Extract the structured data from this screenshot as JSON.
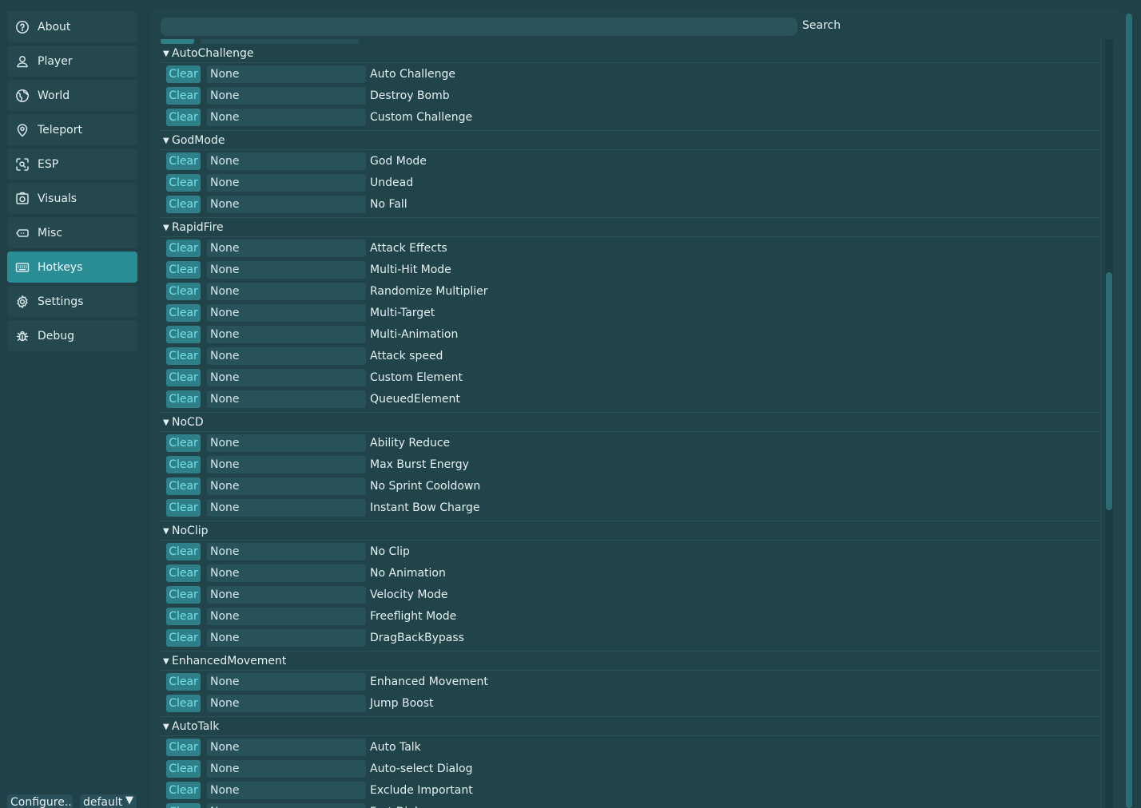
{
  "sidebar": {
    "items": [
      {
        "label": "About",
        "icon": "help-circle-icon"
      },
      {
        "label": "Player",
        "icon": "user-icon"
      },
      {
        "label": "World",
        "icon": "globe-icon"
      },
      {
        "label": "Teleport",
        "icon": "map-pin-icon"
      },
      {
        "label": "ESP",
        "icon": "scan-icon"
      },
      {
        "label": "Visuals",
        "icon": "camera-icon"
      },
      {
        "label": "Misc",
        "icon": "misc-icon"
      },
      {
        "label": "Hotkeys",
        "icon": "keyboard-icon"
      },
      {
        "label": "Settings",
        "icon": "gear-icon"
      },
      {
        "label": "Debug",
        "icon": "bug-icon"
      }
    ],
    "active": "Hotkeys"
  },
  "footer": {
    "configure_label": "Configure...",
    "profile_value": "default"
  },
  "search": {
    "label": "Search",
    "value": ""
  },
  "colors": {
    "background": "#1f4147",
    "accent": "#2a8d96",
    "clear_button": "#2e7f88",
    "clear_text": "#74e0ea"
  },
  "hotkeys": {
    "clear_label": "Clear",
    "groups": [
      {
        "name": "AutoChallenge",
        "items": [
          {
            "key": "None",
            "label": "Auto Challenge"
          },
          {
            "key": "None",
            "label": "Destroy Bomb"
          },
          {
            "key": "None",
            "label": "Custom Challenge"
          }
        ]
      },
      {
        "name": "GodMode",
        "items": [
          {
            "key": "None",
            "label": "God Mode"
          },
          {
            "key": "None",
            "label": "Undead"
          },
          {
            "key": "None",
            "label": "No Fall"
          }
        ]
      },
      {
        "name": "RapidFire",
        "items": [
          {
            "key": "None",
            "label": "Attack Effects"
          },
          {
            "key": "None",
            "label": "Multi-Hit Mode"
          },
          {
            "key": "None",
            "label": "Randomize Multiplier"
          },
          {
            "key": "None",
            "label": "Multi-Target"
          },
          {
            "key": "None",
            "label": "Multi-Animation"
          },
          {
            "key": "None",
            "label": "Attack speed"
          },
          {
            "key": "None",
            "label": "Custom Element"
          },
          {
            "key": "None",
            "label": "QueuedElement"
          }
        ]
      },
      {
        "name": "NoCD",
        "items": [
          {
            "key": "None",
            "label": "Ability Reduce"
          },
          {
            "key": "None",
            "label": "Max Burst Energy"
          },
          {
            "key": "None",
            "label": "No Sprint Cooldown"
          },
          {
            "key": "None",
            "label": "Instant Bow Charge"
          }
        ]
      },
      {
        "name": "NoClip",
        "items": [
          {
            "key": "None",
            "label": "No Clip"
          },
          {
            "key": "None",
            "label": "No Animation"
          },
          {
            "key": "None",
            "label": "Velocity Mode"
          },
          {
            "key": "None",
            "label": "Freeflight Mode"
          },
          {
            "key": "None",
            "label": "DragBackBypass"
          }
        ]
      },
      {
        "name": "EnhancedMovement",
        "items": [
          {
            "key": "None",
            "label": "Enhanced Movement"
          },
          {
            "key": "None",
            "label": "Jump Boost"
          }
        ]
      },
      {
        "name": "AutoTalk",
        "items": [
          {
            "key": "None",
            "label": "Auto Talk"
          },
          {
            "key": "None",
            "label": "Auto-select Dialog"
          },
          {
            "key": "None",
            "label": "Exclude Important"
          },
          {
            "key": "None",
            "label": "Fast Dialog"
          }
        ]
      }
    ]
  }
}
